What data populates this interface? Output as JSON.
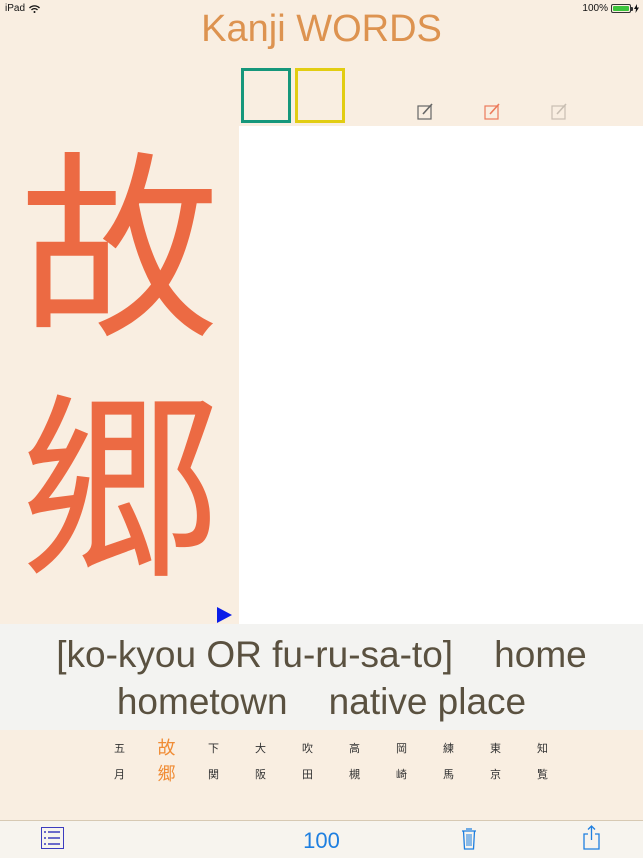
{
  "status_bar": {
    "device": "iPad",
    "battery": "100%"
  },
  "app": {
    "title": "Kanji WORDS"
  },
  "colors": {
    "title": "#dd9350",
    "kanji": "#ec6a43",
    "accent_blue": "#1e7fe0",
    "box_green": "#16977b",
    "box_yellow": "#e2cd12",
    "play": "#0a1de8"
  },
  "big_kanji": [
    "故",
    "郷"
  ],
  "edit_icons": [
    "edit-dark",
    "edit-orange",
    "edit-light"
  ],
  "reading": {
    "line1": "[ko-kyou OR fu-ru-sa-to]    home",
    "line2": "hometown    native place"
  },
  "words": [
    {
      "top": "五",
      "bottom": "月",
      "active": false
    },
    {
      "top": "故",
      "bottom": "郷",
      "active": true
    },
    {
      "top": "下",
      "bottom": "関",
      "active": false
    },
    {
      "top": "大",
      "bottom": "阪",
      "active": false
    },
    {
      "top": "吹",
      "bottom": "田",
      "active": false
    },
    {
      "top": "高",
      "bottom": "槻",
      "active": false
    },
    {
      "top": "岡",
      "bottom": "崎",
      "active": false
    },
    {
      "top": "練",
      "bottom": "馬",
      "active": false
    },
    {
      "top": "東",
      "bottom": "京",
      "active": false
    },
    {
      "top": "知",
      "bottom": "覧",
      "active": false
    }
  ],
  "toolbar": {
    "count": "100"
  }
}
